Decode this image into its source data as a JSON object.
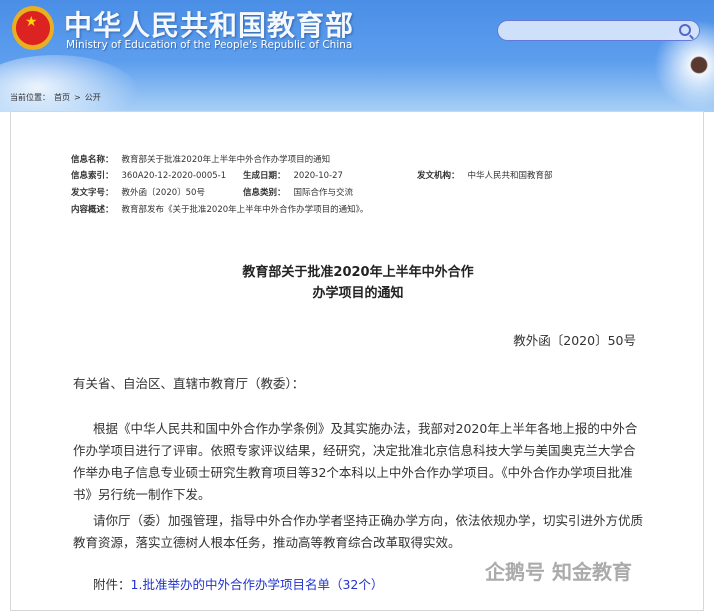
{
  "header": {
    "title_cn": "中华人民共和国教育部",
    "title_en": "Ministry of Education of the People's Republic of China",
    "search_placeholder": ""
  },
  "breadcrumb": {
    "label": "当前位置：",
    "items": [
      "首页",
      "公开"
    ],
    "sep": ">"
  },
  "meta": {
    "name_label": "信息名称：",
    "name": "教育部关于批准2020年上半年中外合作办学项目的通知",
    "index_label": "信息索引：",
    "index": "360A20-12-2020-0005-1",
    "date_label": "生成日期：",
    "date": "2020-10-27",
    "org_label": "发文机构：",
    "org": "中华人民共和国教育部",
    "doc_label": "发文字号：",
    "doc": "教外函〔2020〕50号",
    "cat_label": "信息类别：",
    "cat": "国际合作与交流",
    "summary_label": "内容概述：",
    "summary": "教育部发布《关于批准2020年上半年中外合作办学项目的通知》。"
  },
  "document": {
    "title_line1": "教育部关于批准2020年上半年中外合作",
    "title_line2": "办学项目的通知",
    "number": "教外函〔2020〕50号",
    "greeting": "有关省、自治区、直辖市教育厅（教委）：",
    "para1": "根据《中华人民共和国中外合作办学条例》及其实施办法，我部对2020年上半年各地上报的中外合作办学项目进行了评审。依照专家评议结果，经研究，决定批准北京信息科技大学与美国奥克兰大学合作举办电子信息专业硕士研究生教育项目等32个本科以上中外合作办学项目。《中外合作办学项目批准书》另行统一制作下发。",
    "para2": "请你厅（委）加强管理，指导中外合作办学者坚持正确办学方向，依法依规办学，切实引进外方优质教育资源，落实立德树人根本任务，推动高等教育综合改革取得实效。",
    "attachment_label": "附件：",
    "attachment_link": "1.批准举办的中外合作办学项目名单（32个）"
  },
  "watermark": "企鹅号 知金教育"
}
